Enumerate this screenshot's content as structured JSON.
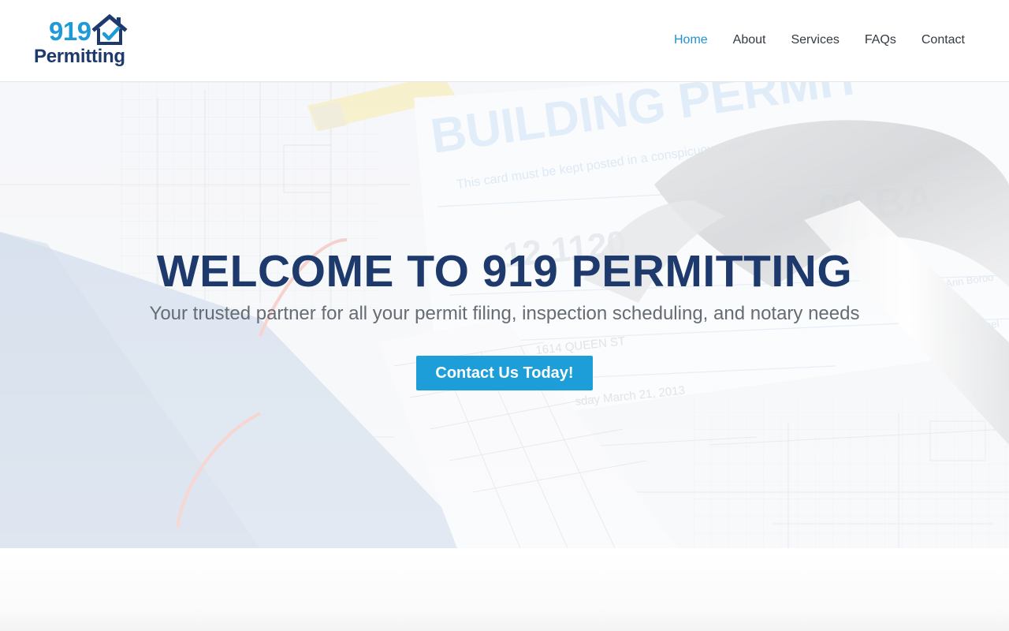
{
  "logo": {
    "number": "919",
    "word": "Permitting",
    "icon": "house-check-icon",
    "colors": {
      "primary_blue": "#1f9ad6",
      "navy": "#1e3a6d"
    }
  },
  "nav": {
    "items": [
      {
        "label": "Home",
        "active": true
      },
      {
        "label": "About",
        "active": false
      },
      {
        "label": "Services",
        "active": false
      },
      {
        "label": "FAQs",
        "active": false
      },
      {
        "label": "Contact",
        "active": false
      }
    ]
  },
  "hero": {
    "title": "WELCOME TO 919 PERMITTING",
    "subtitle": "Your trusted partner for all your permit filing, inspection scheduling, and notary needs",
    "cta_label": "Contact Us Today!",
    "background_image": "building-permit-blueprints-hammer",
    "colors": {
      "title": "#1e3a6d",
      "button": "#1e9ed9"
    }
  }
}
